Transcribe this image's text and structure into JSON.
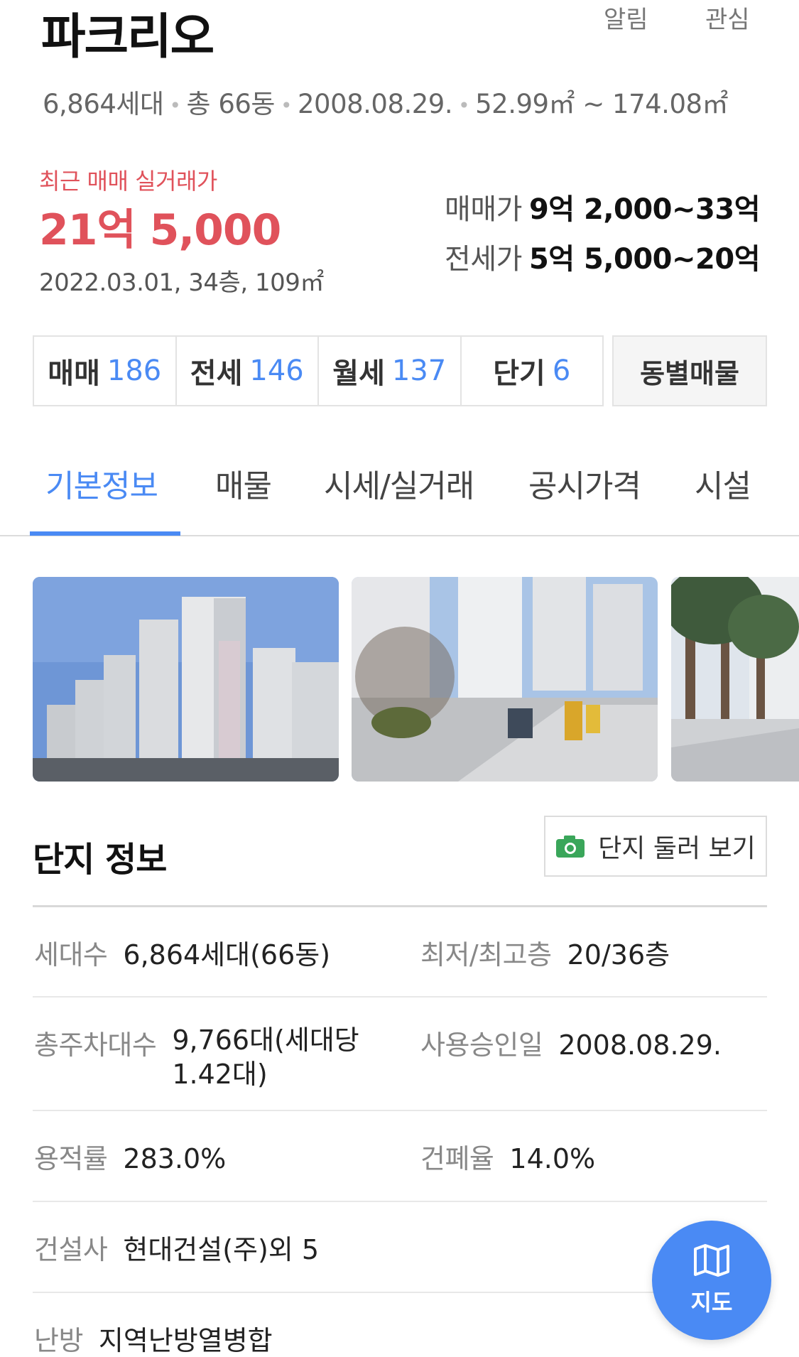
{
  "header": {
    "title": "파크리오",
    "actions": {
      "alarm": "알림",
      "favorite": "관심"
    },
    "meta": {
      "households": "6,864세대",
      "buildings": "총 66동",
      "approval_date": "2008.08.29.",
      "area_range": "52.99㎡ ~ 174.08㎡"
    }
  },
  "price": {
    "recent_label": "최근 매매 실거래가",
    "recent_value": "21억 5,000",
    "recent_detail": "2022.03.01, 34층, 109㎡",
    "sale_label": "매매가",
    "sale_range": "9억 2,000~33억",
    "jeonse_label": "전세가",
    "jeonse_range": "5억 5,000~20억"
  },
  "counts": [
    {
      "label": "매매",
      "value": "186"
    },
    {
      "label": "전세",
      "value": "146"
    },
    {
      "label": "월세",
      "value": "137"
    },
    {
      "label": "단기",
      "value": "6"
    }
  ],
  "by_dong_label": "동별매물",
  "tabs": [
    {
      "label": "기본정보",
      "active": true
    },
    {
      "label": "매물",
      "active": false
    },
    {
      "label": "시세/실거래",
      "active": false
    },
    {
      "label": "공시가격",
      "active": false
    },
    {
      "label": "시설",
      "active": false
    }
  ],
  "section": {
    "title": "단지 정보",
    "tour_button": "단지 둘러 보기"
  },
  "info": {
    "households_label": "세대수",
    "households_value": "6,864세대(66동)",
    "floors_label": "최저/최고층",
    "floors_value": "20/36층",
    "parking_label": "총주차대수",
    "parking_value": "9,766대(세대당 1.42대)",
    "approval_label": "사용승인일",
    "approval_value": "2008.08.29.",
    "far_label": "용적률",
    "far_value": "283.0%",
    "bcr_label": "건폐율",
    "bcr_value": "14.0%",
    "builder_label": "건설사",
    "builder_value": "현대건설(주)외 5",
    "heating_label": "난방",
    "heating_value": "지역난방열병합"
  },
  "map_fab": {
    "label": "지도",
    "icon": "map-icon"
  },
  "colors": {
    "accent": "#4a8af4",
    "price_red": "#e0525b",
    "camera_green": "#3aa65a"
  }
}
